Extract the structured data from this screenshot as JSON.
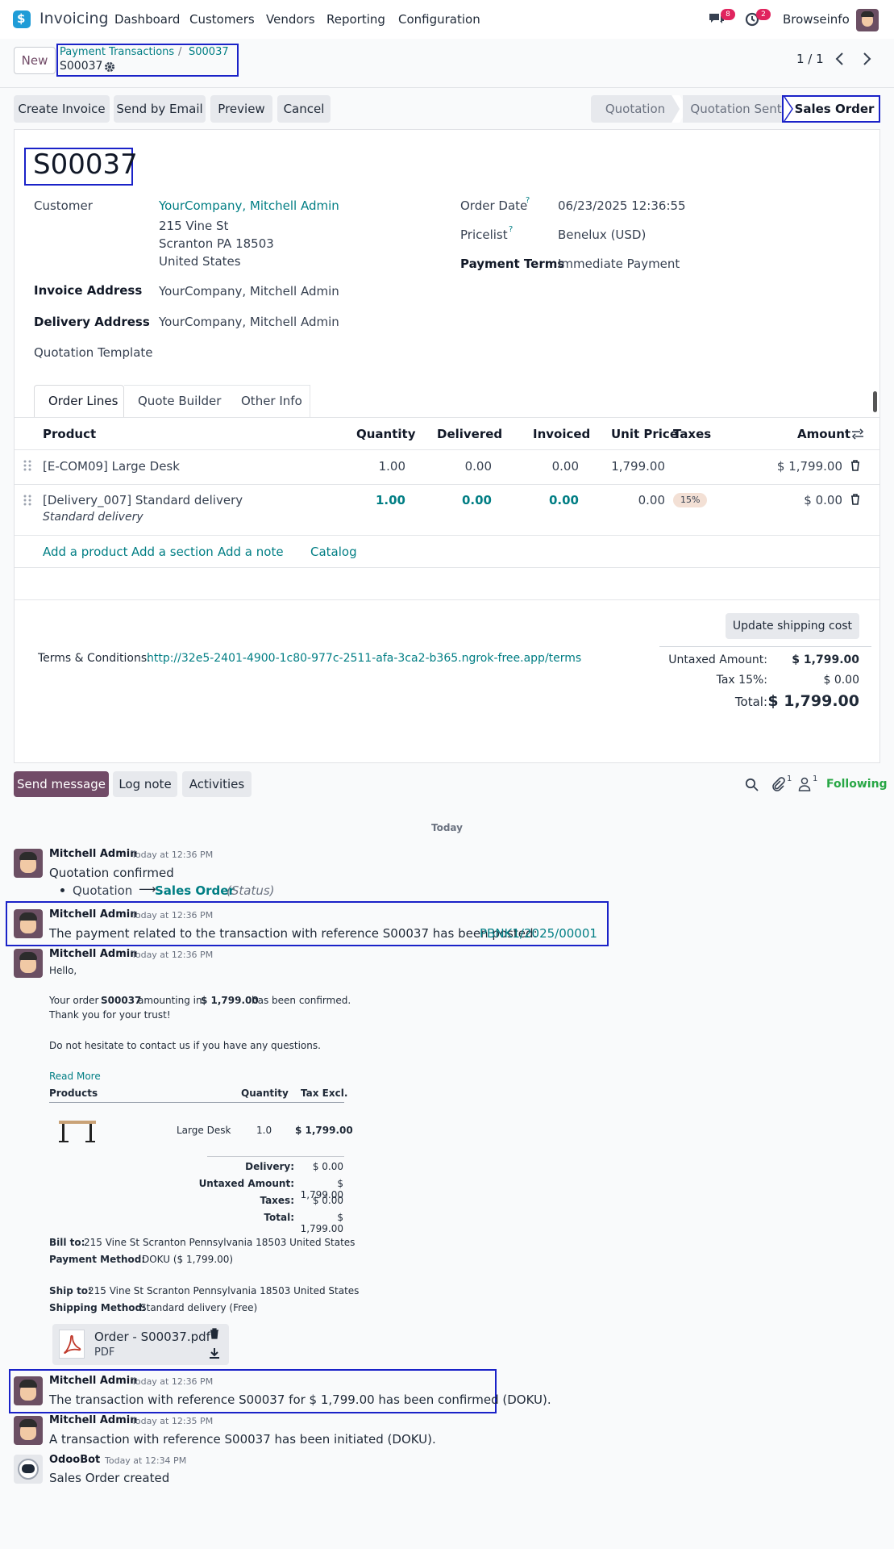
{
  "nav": {
    "app_title": "Invoicing",
    "menu": [
      "Dashboard",
      "Customers",
      "Vendors",
      "Reporting",
      "Configuration"
    ],
    "messages_badge": "8",
    "activities_badge": "2",
    "company": "Browseinfo"
  },
  "control": {
    "new_label": "New",
    "breadcrumb_parent": "Payment Transactions",
    "breadcrumb_sep": "/",
    "breadcrumb_link": "S00037",
    "record_name": "S00037",
    "pager": "1 / 1"
  },
  "actions": {
    "create_invoice": "Create Invoice",
    "send_email": "Send by Email",
    "preview": "Preview",
    "cancel": "Cancel"
  },
  "status": {
    "steps": [
      "Quotation",
      "Quotation Sent",
      "Sales Order"
    ],
    "active": "Sales Order"
  },
  "form": {
    "order_name": "S00037",
    "customer_label": "Customer",
    "customer_name": "YourCompany, Mitchell Admin",
    "address_line1": "215 Vine St",
    "address_line2": "Scranton PA 18503",
    "address_line3": "United States",
    "invoice_address_label": "Invoice Address",
    "invoice_address": "YourCompany, Mitchell Admin",
    "delivery_address_label": "Delivery Address",
    "delivery_address": "YourCompany, Mitchell Admin",
    "quotation_template_label": "Quotation Template",
    "order_date_label": "Order Date",
    "order_date": "06/23/2025 12:36:55",
    "pricelist_label": "Pricelist",
    "pricelist": "Benelux (USD)",
    "payment_terms_label": "Payment Terms",
    "payment_terms": "Immediate Payment",
    "help_mark": "?"
  },
  "tabs": [
    "Order Lines",
    "Quote Builder",
    "Other Info"
  ],
  "table": {
    "headers": {
      "product": "Product",
      "quantity": "Quantity",
      "delivered": "Delivered",
      "invoiced": "Invoiced",
      "unit_price": "Unit Price",
      "taxes": "Taxes",
      "amount": "Amount"
    },
    "rows": [
      {
        "product": "[E-COM09] Large Desk",
        "description": "",
        "quantity": "1.00",
        "delivered": "0.00",
        "invoiced": "0.00",
        "unit_price": "1,799.00",
        "taxes": "",
        "amount": "$ 1,799.00"
      },
      {
        "product": "[Delivery_007] Standard delivery",
        "description": "Standard delivery",
        "quantity": "1.00",
        "delivered": "0.00",
        "invoiced": "0.00",
        "unit_price": "0.00",
        "taxes": "15%",
        "amount": "$ 0.00"
      }
    ],
    "add_product": "Add a product",
    "add_section": "Add a section",
    "add_note": "Add a note",
    "catalog": "Catalog"
  },
  "totals": {
    "update_shipping": "Update shipping cost",
    "terms_label": "Terms & Conditions:",
    "terms_link": "http://32e5-2401-4900-1c80-977c-2511-afa-3ca2-b365.ngrok-free.app/terms",
    "untaxed_label": "Untaxed Amount:",
    "untaxed": "$ 1,799.00",
    "tax_label": "Tax 15%:",
    "tax": "$ 0.00",
    "total_label": "Total:",
    "total": "$ 1,799.00"
  },
  "chatter": {
    "send_message": "Send message",
    "log_note": "Log note",
    "activities": "Activities",
    "attachments_count": "1",
    "followers_count": "1",
    "following": "Following",
    "date_separator": "Today",
    "messages": [
      {
        "author": "Mitchell Admin",
        "time": "Today at 12:36 PM",
        "body": "Quotation confirmed",
        "change_from": "Quotation",
        "change_arrow": "⟶",
        "change_to": "Sales Order",
        "change_field": "(Status)"
      },
      {
        "author": "Mitchell Admin",
        "time": "Today at 12:36 PM",
        "body": "The payment related to the transaction with reference S00037 has been posted:",
        "link": "PBNK1/2025/00001"
      },
      {
        "author": "Mitchell Admin",
        "time": "Today at 12:36 PM"
      },
      {
        "author": "Mitchell Admin",
        "time": "Today at 12:36 PM",
        "body": "The transaction with reference S00037 for $ 1,799.00 has been confirmed (DOKU)."
      },
      {
        "author": "Mitchell Admin",
        "time": "Today at 12:35 PM",
        "body": "A transaction with reference S00037 has been initiated (DOKU)."
      },
      {
        "author": "OdooBot",
        "time": "Today at 12:34 PM",
        "body": "Sales Order created"
      }
    ],
    "email": {
      "hello": "Hello,",
      "line1_a": "Your order",
      "line1_order": "S00037",
      "line1_b": "amounting in",
      "line1_amount": "$ 1,799.00",
      "line1_c": "has been confirmed.",
      "thanks": "Thank you for your trust!",
      "contact": "Do not hesitate to contact us if you have any questions.",
      "read_more": "Read More",
      "col_products": "Products",
      "col_quantity": "Quantity",
      "col_tax_excl": "Tax Excl.",
      "item_name": "Large Desk",
      "item_qty": "1.0",
      "item_price": "$ 1,799.00",
      "delivery_label": "Delivery:",
      "delivery": "$ 0.00",
      "untaxed_label": "Untaxed Amount:",
      "untaxed": "$ 1,799.00",
      "taxes_label": "Taxes:",
      "taxes": "$ 0.00",
      "total_label": "Total:",
      "total": "$ 1,799.00",
      "bill_to_label": "Bill to:",
      "bill_to": "215 Vine St Scranton Pennsylvania 18503 United States",
      "payment_method_label": "Payment Method:",
      "payment_method": "DOKU ($ 1,799.00)",
      "ship_to_label": "Ship to:",
      "ship_to": "215 Vine St Scranton Pennsylvania 18503 United States",
      "shipping_method_label": "Shipping Method:",
      "shipping_method": "Standard delivery (Free)",
      "attachment_name": "Order - S00037.pdf",
      "attachment_type": "PDF"
    }
  },
  "colors": {
    "brand": "#714b67",
    "link": "#017e84",
    "highlight": "#1a22c8",
    "following": "#28a745"
  }
}
